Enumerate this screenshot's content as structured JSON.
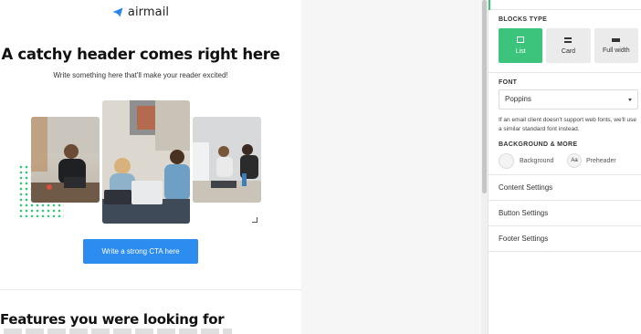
{
  "email": {
    "logo_text": "airmail",
    "headline": "A catchy header comes right here",
    "subline": "Write something here that'll make your reader excited!",
    "cta_label": "Write a strong CTA here",
    "features_heading": "Features you were looking for"
  },
  "panel": {
    "blocks_type_label": "BLOCKS TYPE",
    "blocks": [
      {
        "label": "List",
        "icon": "list-icon",
        "active": true
      },
      {
        "label": "Card",
        "icon": "card-icon",
        "active": false
      },
      {
        "label": "Full width",
        "icon": "full-width-icon",
        "active": false
      }
    ],
    "font_label": "FONT",
    "font_value": "Poppins",
    "font_note": "If an email client doesn't support web fonts, we'll use a similar standard font instead.",
    "background_label": "BACKGROUND & MORE",
    "background_item": "Background",
    "preheader_icon_text": "Aa",
    "preheader_item": "Preheader",
    "accordion": [
      "Content Settings",
      "Button Settings",
      "Footer Settings"
    ]
  },
  "colors": {
    "accent_green": "#3cc47c",
    "cta_blue": "#2d8cf0"
  }
}
